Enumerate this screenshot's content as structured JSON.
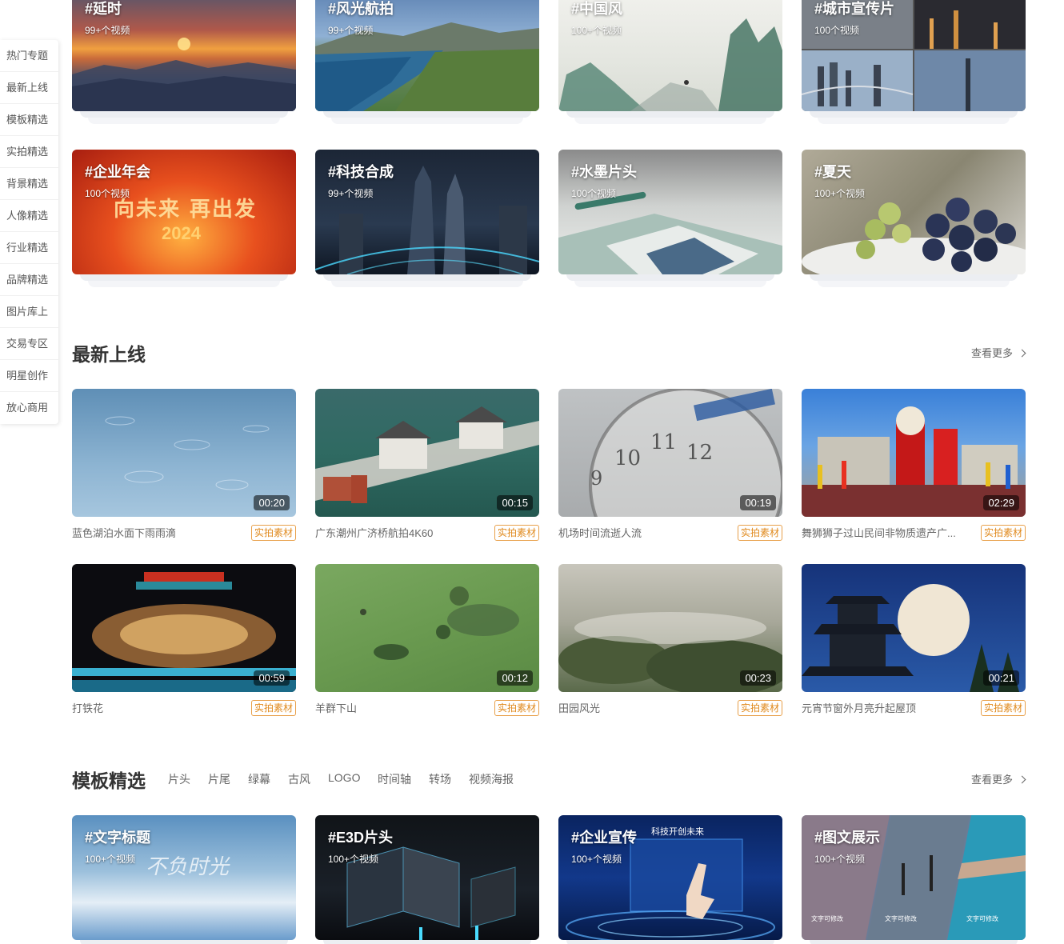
{
  "sidenav": {
    "items": [
      "热门专题",
      "最新上线",
      "模板精选",
      "实拍精选",
      "背景精选",
      "人像精选",
      "行业精选",
      "品牌精选",
      "图片库上",
      "交易专区",
      "明星创作",
      "放心商用"
    ]
  },
  "topics_row1": [
    {
      "title": "#延时",
      "count": "99+个视频"
    },
    {
      "title": "#风光航拍",
      "count": "99+个视频"
    },
    {
      "title": "#中国风",
      "count": "100+个视频"
    },
    {
      "title": "#城市宣传片",
      "count": "100个视频"
    }
  ],
  "topics_row2": [
    {
      "title": "#企业年会",
      "count": "100个视频",
      "overlay_text": "向未来 再出发",
      "overlay_year": "2024"
    },
    {
      "title": "#科技合成",
      "count": "99+个视频"
    },
    {
      "title": "#水墨片头",
      "count": "100个视频"
    },
    {
      "title": "#夏天",
      "count": "100+个视频"
    }
  ],
  "latest": {
    "title": "最新上线",
    "more": "查看更多",
    "videos": [
      {
        "name": "蓝色湖泊水面下雨雨滴",
        "duration": "00:20",
        "tag": "实拍素材"
      },
      {
        "name": "广东潮州广济桥航拍4K60",
        "duration": "00:15",
        "tag": "实拍素材"
      },
      {
        "name": "机场时间流逝人流",
        "duration": "00:19",
        "tag": "实拍素材"
      },
      {
        "name": "舞狮狮子过山民间非物质遗产广...",
        "duration": "02:29",
        "tag": "实拍素材"
      },
      {
        "name": "打铁花",
        "duration": "00:59",
        "tag": "实拍素材"
      },
      {
        "name": "羊群下山",
        "duration": "00:12",
        "tag": "实拍素材"
      },
      {
        "name": "田园风光",
        "duration": "00:23",
        "tag": "实拍素材"
      },
      {
        "name": "元宵节窗外月亮升起屋顶",
        "duration": "00:21",
        "tag": "实拍素材"
      }
    ]
  },
  "templates": {
    "title": "模板精选",
    "more": "查看更多",
    "tabs": [
      "片头",
      "片尾",
      "绿幕",
      "古风",
      "LOGO",
      "时间轴",
      "转场",
      "视频海报"
    ],
    "cards": [
      {
        "title": "#文字标题",
        "count": "100+个视频",
        "overlay": "不负时光"
      },
      {
        "title": "#E3D片头",
        "count": "100+个视频"
      },
      {
        "title": "#企业宣传",
        "count": "100+个视频",
        "overlay": "科技开创未来"
      },
      {
        "title": "#图文展示",
        "count": "100+个视频",
        "captions": [
          "文字可修改",
          "文字可修改",
          "文字可修改"
        ]
      }
    ]
  }
}
